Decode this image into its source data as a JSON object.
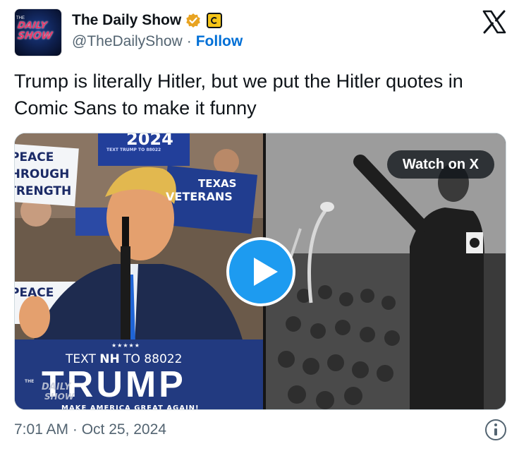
{
  "author": {
    "display_name": "The Daily Show",
    "handle": "@TheDailyShow",
    "separator": "·",
    "follow_label": "Follow",
    "avatar_text_top": "DAILY",
    "avatar_text_bottom": "SHOW",
    "avatar_mark": "THE"
  },
  "tweet": {
    "text": "Trump is literally Hitler, but we put the Hitler quotes in Comic Sans to make it funny"
  },
  "media": {
    "watch_label": "Watch on X",
    "left_panel": {
      "sign_year": "2024",
      "sign_small": "TEXT TRUMP TO 88022",
      "sign_peace_1": "PEACE",
      "sign_peace_2": "THROUGH",
      "sign_peace_3": "STRENGTH",
      "sign_peace_bottom": "PEACE",
      "sign_veterans_1": "TEXAS",
      "sign_veterans_2": "VETERANS",
      "podium_stars": "★★★★★",
      "podium_text_prefix": "TEXT ",
      "podium_text_bold": "NH",
      "podium_text_suffix": " TO 88022",
      "podium_name": "TRUMP",
      "podium_slogan": "MAKE AMERICA GREAT AGAIN!",
      "watermark_top": "THE",
      "watermark_mid": "DAILY",
      "watermark_bot": "SHOW"
    }
  },
  "footer": {
    "timestamp": "7:01 AM · Oct 25, 2024"
  },
  "colors": {
    "follow": "#006fd6",
    "play": "#1d9bf0",
    "verified": "#e8a321"
  },
  "icons": {
    "verified": "verified-gold-badge-icon",
    "affiliate": "comedy-central-logo-icon",
    "x_logo": "x-logo-icon",
    "play": "play-icon",
    "info": "info-icon"
  }
}
